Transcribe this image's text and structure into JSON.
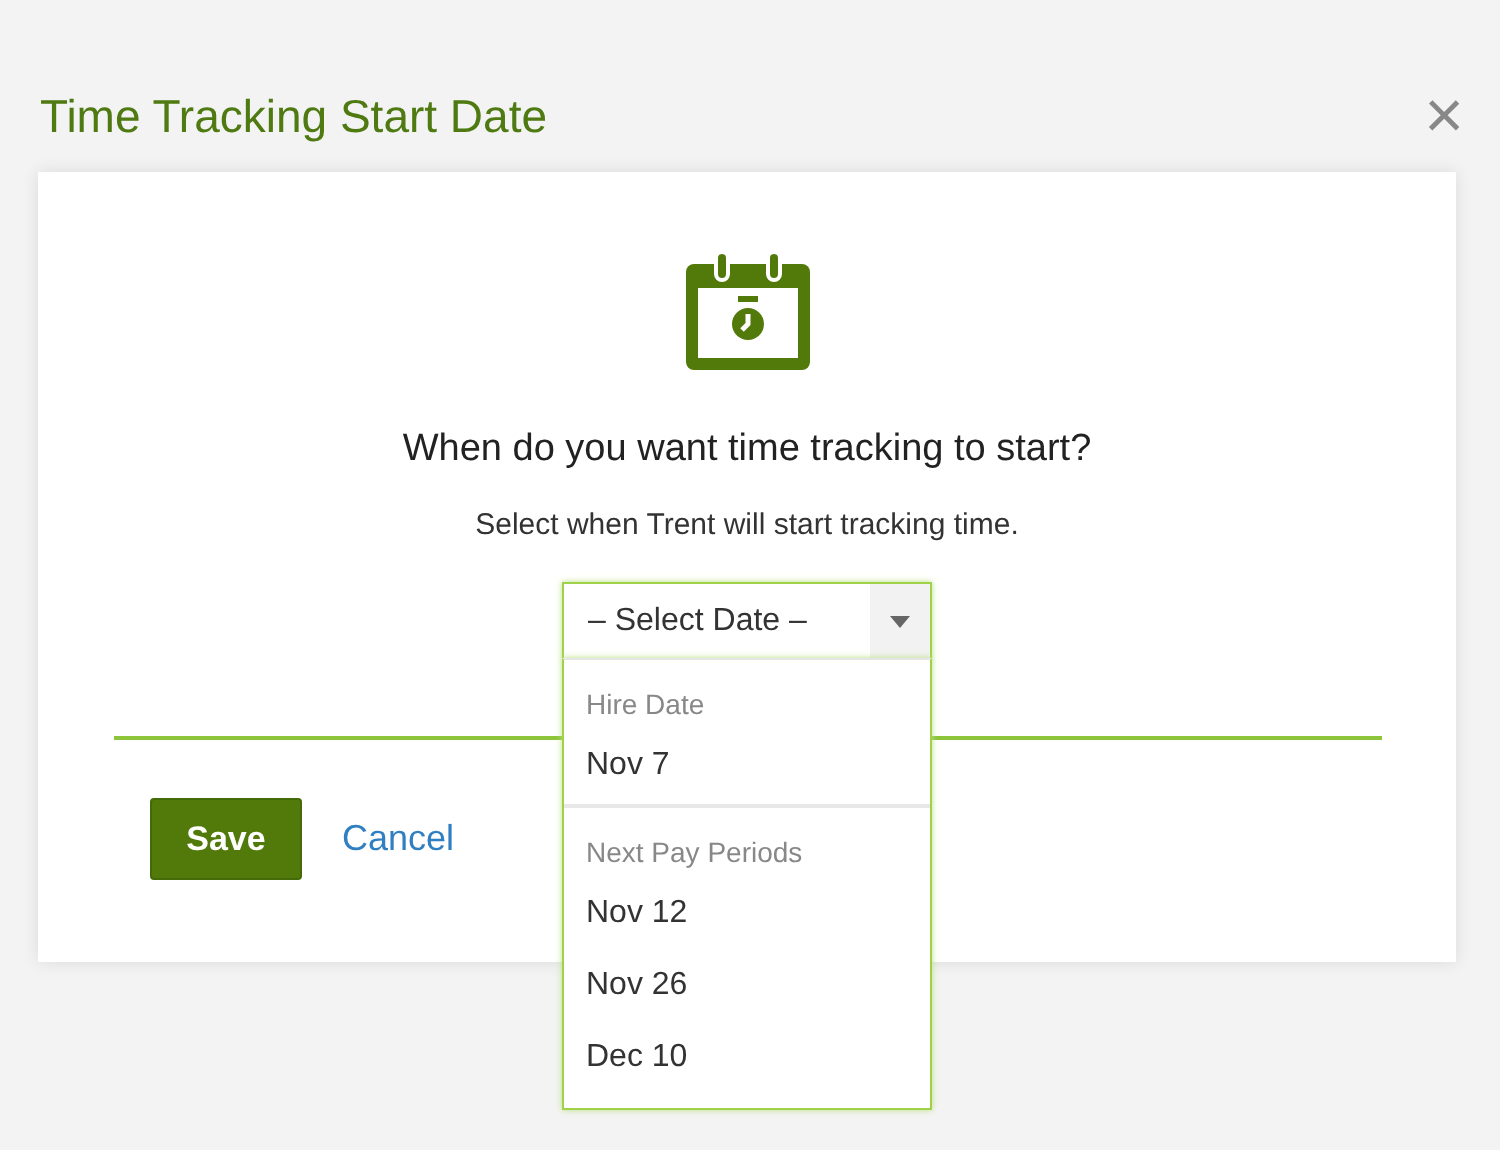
{
  "dialog": {
    "title": "Time Tracking Start Date",
    "close": "×"
  },
  "question": "When do you want time tracking to start?",
  "description": "Select when Trent will start tracking time.",
  "select": {
    "placeholder": "– Select Date –",
    "expanded": true,
    "groups": [
      {
        "label": "Hire Date",
        "options": [
          "Nov 7"
        ]
      },
      {
        "label": "Next Pay Periods",
        "options": [
          "Nov 12",
          "Nov 26",
          "Dec 10"
        ]
      }
    ]
  },
  "buttons": {
    "save": "Save",
    "cancel": "Cancel"
  }
}
